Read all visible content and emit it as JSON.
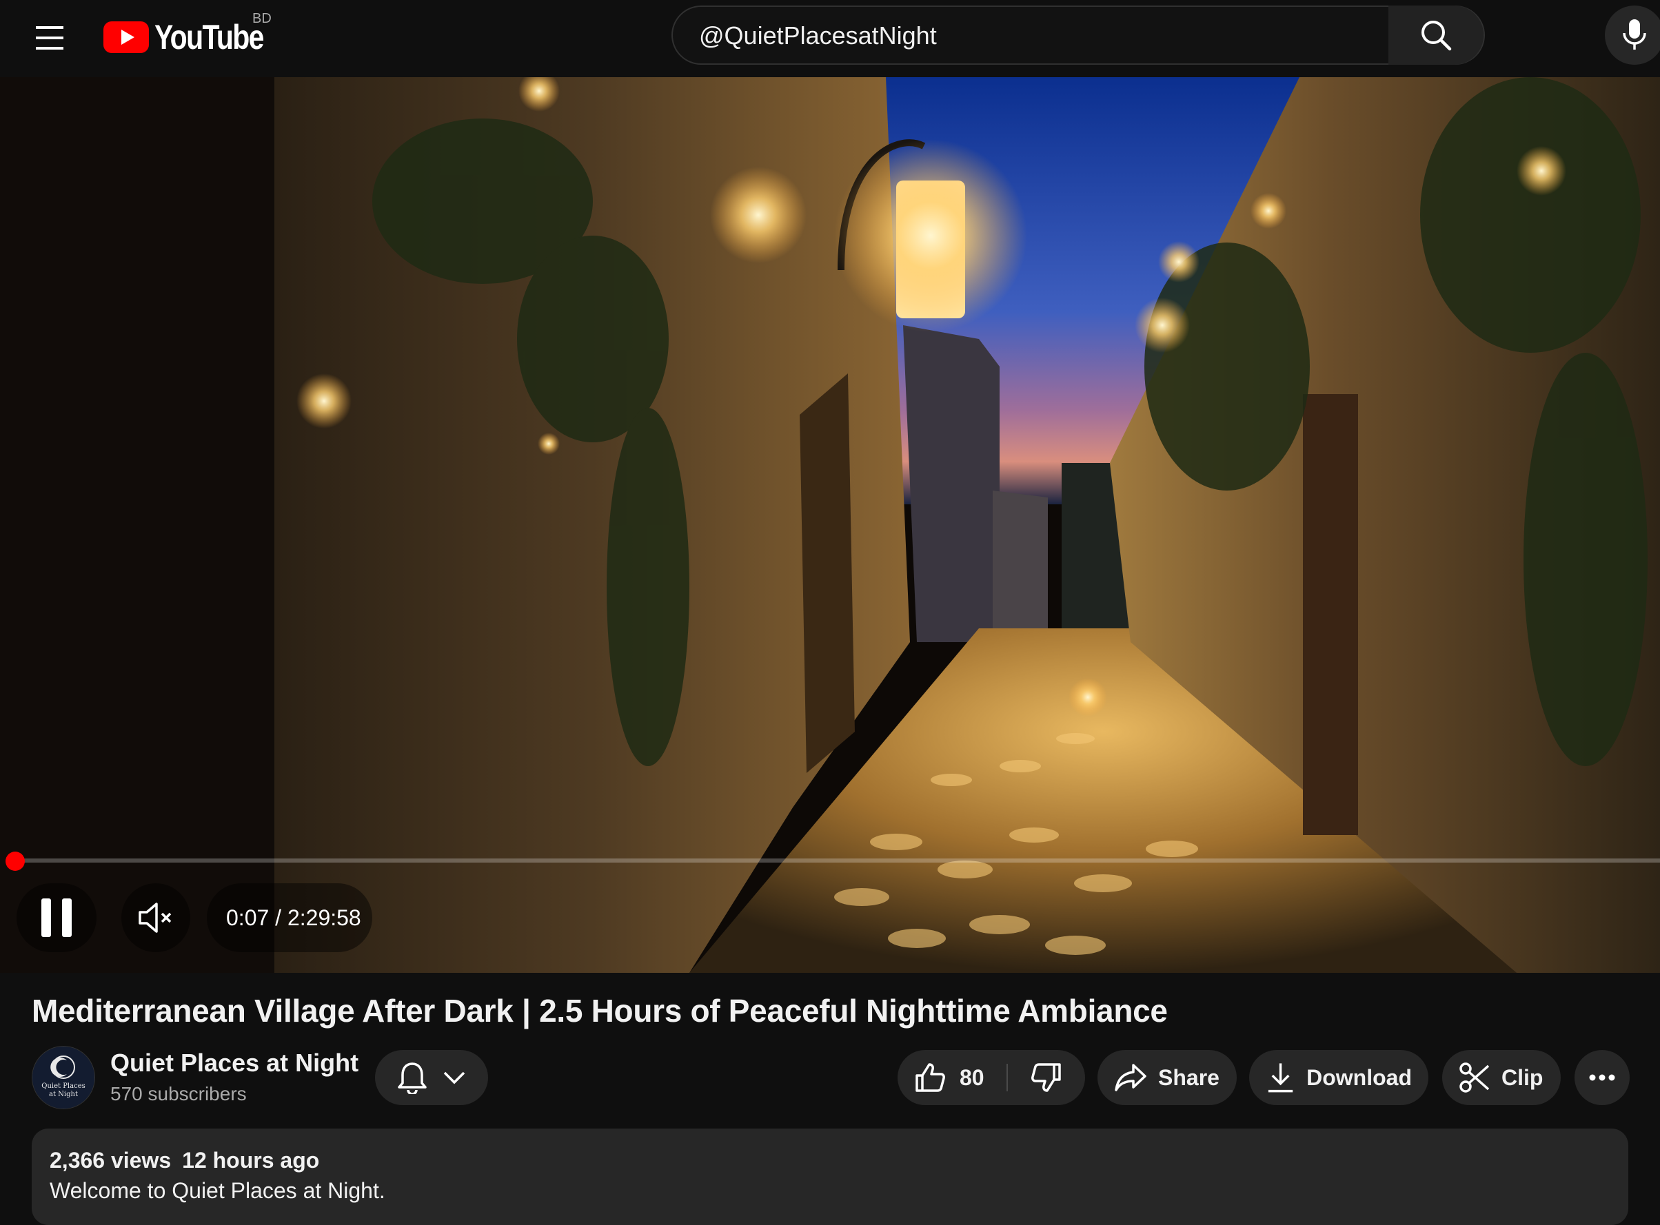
{
  "header": {
    "logo_text": "YouTube",
    "country_code": "BD",
    "search_value": "@QuietPlacesatNight",
    "icons": [
      "menu-icon",
      "youtube-logo-icon",
      "close-icon",
      "search-icon",
      "microphone-icon"
    ]
  },
  "player": {
    "time_display": "0:07 / 2:29:58",
    "progress_fraction": 0.0008,
    "state": "playing",
    "muted": true,
    "accent_color": "#ff0000",
    "icons": [
      "pause-icon",
      "volume-muted-icon"
    ]
  },
  "video": {
    "title": "Mediterranean Village After Dark | 2.5 Hours of Peaceful Nighttime Ambiance",
    "views": "2,366 views",
    "published": "12 hours ago",
    "description": "Welcome to Quiet Places at Night."
  },
  "channel": {
    "name": "Quiet Places at Night",
    "subscribers": "570 subscribers",
    "avatar_text_line1": "Quiet Places",
    "avatar_text_line2": "at Night"
  },
  "actions": {
    "like_count": "80",
    "share_label": "Share",
    "download_label": "Download",
    "clip_label": "Clip",
    "icons": [
      "bell-icon",
      "chevron-down-icon",
      "thumbs-up-icon",
      "thumbs-down-icon",
      "share-icon",
      "download-icon",
      "scissors-icon",
      "more-icon"
    ]
  }
}
